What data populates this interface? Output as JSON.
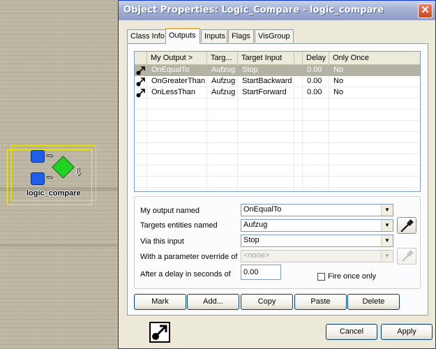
{
  "viewport": {
    "entity_label": "logic_compare"
  },
  "dialog": {
    "title": "Object Properties: Logic_Compare - logic_compare",
    "close_label": "✕",
    "tabs": [
      {
        "label": "Class Info",
        "active": false
      },
      {
        "label": "Outputs",
        "active": true
      },
      {
        "label": "Inputs",
        "active": false
      },
      {
        "label": "Flags",
        "active": false
      },
      {
        "label": "VisGroup",
        "active": false
      }
    ]
  },
  "outputs_list": {
    "columns": [
      "My Output >",
      "Targ...",
      "Target Input",
      "",
      "Delay",
      "Only Once"
    ],
    "rows": [
      {
        "output": "OnEqualTo",
        "target": "Aufzug",
        "input": "Stop",
        "delay": "0.00",
        "once": "No",
        "selected": true
      },
      {
        "output": "OnGreaterThan",
        "target": "Aufzug",
        "input": "StartBackward",
        "delay": "0.00",
        "once": "No",
        "selected": false
      },
      {
        "output": "OnLessThan",
        "target": "Aufzug",
        "input": "StartForward",
        "delay": "0.00",
        "once": "No",
        "selected": false
      }
    ]
  },
  "properties": {
    "output_named_label": "My output named",
    "output_named_value": "OnEqualTo",
    "targets_label": "Targets entities named",
    "targets_value": "Aufzug",
    "via_input_label": "Via this input",
    "via_input_value": "Stop",
    "param_override_label": "With a parameter override of",
    "param_override_value": "<none>",
    "delay_label": "After a delay in seconds of",
    "delay_value": "0.00",
    "fire_once_label": "Fire once only",
    "fire_once_checked": false
  },
  "buttons": {
    "mark": "Mark",
    "add": "Add...",
    "copy": "Copy",
    "paste": "Paste",
    "delete": "Delete",
    "cancel": "Cancel",
    "apply": "Apply"
  },
  "icons": {
    "output_row": "output-connection-icon",
    "eyedropper": "eyedropper-icon",
    "dropdown": "chevron-down-icon"
  },
  "colors": {
    "titlebar": "#a7b3d6",
    "selected_row": "#b3b2a3",
    "entity_box": "#f4f000",
    "entity_blue": "#1f5fe8",
    "entity_green": "#23d323"
  }
}
